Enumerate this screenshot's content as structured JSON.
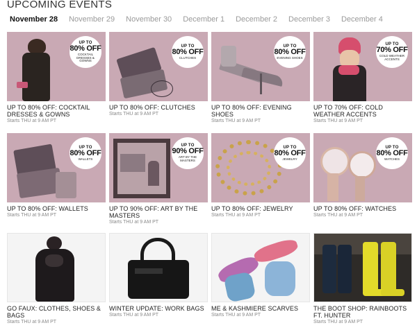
{
  "header": {
    "title": "UPCOMING EVENTS"
  },
  "tabs": [
    {
      "label": "November 28",
      "active": true
    },
    {
      "label": "November 29",
      "active": false
    },
    {
      "label": "November 30",
      "active": false
    },
    {
      "label": "December 1",
      "active": false
    },
    {
      "label": "December 2",
      "active": false
    },
    {
      "label": "December 3",
      "active": false
    },
    {
      "label": "December 4",
      "active": false
    }
  ],
  "events": [
    {
      "title": "UP TO 80% OFF: COCKTAIL DRESSES & GOWNS",
      "starts": "Starts THU at 9 AM PT",
      "badge": {
        "top": "UP TO",
        "pct": "80% OFF",
        "sub": "COCKTAIL DRESSES & GOWNS"
      },
      "icon": "dress-photo"
    },
    {
      "title": "UP TO 80% OFF: CLUTCHES",
      "starts": "Starts THU at 9 AM PT",
      "badge": {
        "top": "UP TO",
        "pct": "80% OFF",
        "sub": "CLUTCHES"
      },
      "icon": "clutch-photo"
    },
    {
      "title": "UP TO 80% OFF: EVENING SHOES",
      "starts": "Starts THU at 9 AM PT",
      "badge": {
        "top": "UP TO",
        "pct": "80% OFF",
        "sub": "EVENING SHOES"
      },
      "icon": "shoes-photo"
    },
    {
      "title": "UP TO 70% OFF: COLD WEATHER ACCENTS",
      "starts": "Starts THU at 9 AM PT",
      "badge": {
        "top": "UP TO",
        "pct": "70% OFF",
        "sub": "COLD WEATHER ACCENTS"
      },
      "icon": "winter-hat-photo"
    },
    {
      "title": "UP TO 80% OFF: WALLETS",
      "starts": "Starts THU at 9 AM PT",
      "badge": {
        "top": "UP TO",
        "pct": "80% OFF",
        "sub": "WALLETS"
      },
      "icon": "wallet-photo"
    },
    {
      "title": "UP TO 90% OFF: ART BY THE MASTERS",
      "starts": "Starts THU at 9 AM PT",
      "badge": {
        "top": "UP TO",
        "pct": "90% OFF",
        "sub": "ART BY THE MASTERS"
      },
      "icon": "painting-photo"
    },
    {
      "title": "UP TO 80% OFF: JEWELRY",
      "starts": "Starts THU at 9 AM PT",
      "badge": {
        "top": "UP TO",
        "pct": "80% OFF",
        "sub": "JEWELRY"
      },
      "icon": "necklace-photo"
    },
    {
      "title": "UP TO 80% OFF: WATCHES",
      "starts": "Starts THU at 9 AM PT",
      "badge": {
        "top": "UP TO",
        "pct": "80% OFF",
        "sub": "WATCHES"
      },
      "icon": "watch-photo"
    },
    {
      "title": "GO FAUX: CLOTHES, SHOES & BAGS",
      "starts": "Starts THU at 9 AM PT",
      "icon": "fur-coat-photo"
    },
    {
      "title": "WINTER UPDATE: WORK BAGS",
      "starts": "Starts THU at 9 AM PT",
      "icon": "handbag-photo"
    },
    {
      "title": "ME & KASHMIERE SCARVES",
      "starts": "Starts THU at 9 AM PT",
      "icon": "scarf-photo"
    },
    {
      "title": "THE BOOT SHOP: RAINBOOTS FT. HUNTER",
      "starts": "Starts THU at 9 AM PT",
      "icon": "rainboots-photo"
    }
  ],
  "colors": {
    "tint": "#c9a9b4",
    "active_tab": "#111111",
    "inactive_tab": "#9a9a9a",
    "meta": "#888888"
  }
}
